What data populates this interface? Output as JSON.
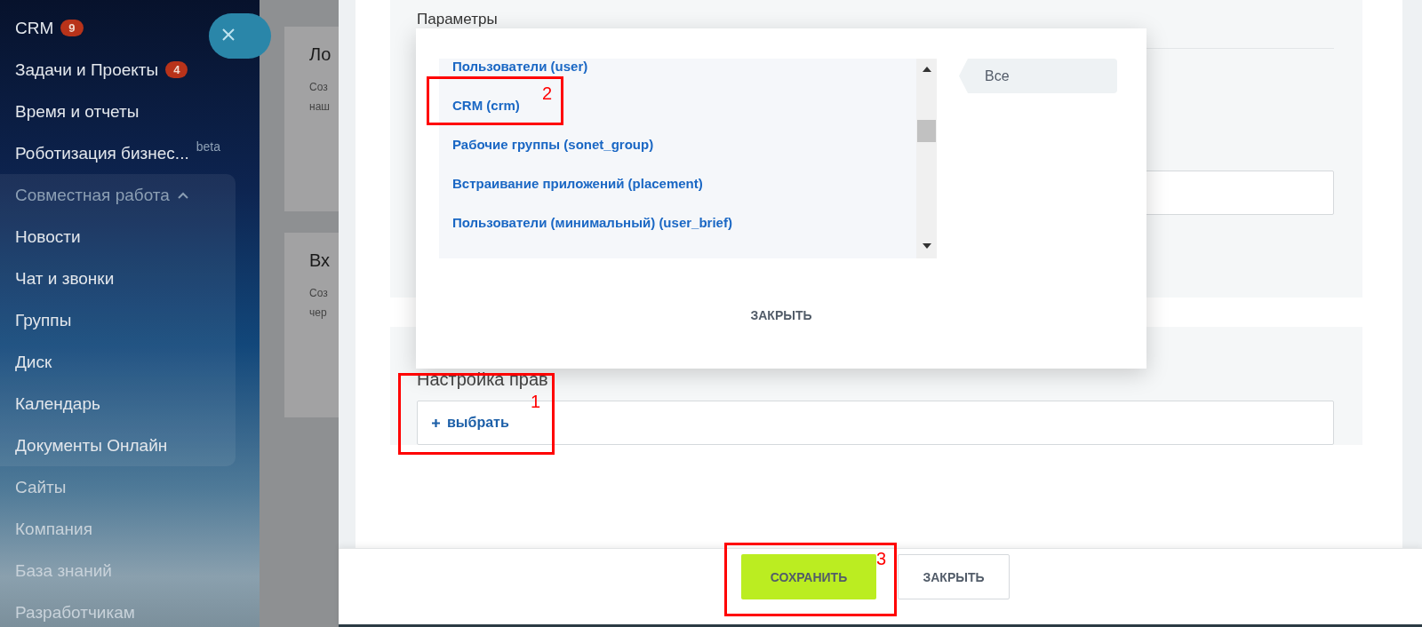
{
  "sidebar": {
    "items": [
      {
        "label": "CRM",
        "badge": "9"
      },
      {
        "label": "Задачи и Проекты",
        "badge": "4"
      },
      {
        "label": "Время и отчеты"
      },
      {
        "label": "Роботизация бизнес...",
        "superscript": "beta"
      },
      {
        "label": "Совместная работа",
        "expanded": true,
        "children": [
          {
            "label": "Новости"
          },
          {
            "label": "Чат и звонки"
          },
          {
            "label": "Группы"
          },
          {
            "label": "Диск"
          },
          {
            "label": "Календарь"
          },
          {
            "label": "Документы Онлайн"
          }
        ]
      },
      {
        "label": "Сайты"
      },
      {
        "label": "Компания"
      },
      {
        "label": "База знаний"
      },
      {
        "label": "Разработчикам"
      }
    ]
  },
  "background_cards": [
    {
      "title": "Ло",
      "lines": [
        "Соз",
        "наш"
      ]
    },
    {
      "title": "Вх",
      "lines": [
        "Соз",
        "чер"
      ]
    }
  ],
  "form": {
    "sections": [
      {
        "title": "Параметры"
      },
      {
        "title": "Настройка прав",
        "picker": "выбрать"
      }
    ]
  },
  "scope_popup": {
    "items": [
      "Пользователи (user)",
      "CRM (crm)",
      "Рабочие группы (sonet_group)",
      "Встраивание приложений (placement)",
      "Пользователи (минимальный) (user_brief)"
    ],
    "tag": "Все",
    "close": "ЗАКРЫТЬ"
  },
  "footer": {
    "buttons": [
      {
        "label": "СОХРАНИТЬ",
        "kind": "primary"
      },
      {
        "label": "ЗАКРЫТЬ",
        "kind": "secondary"
      }
    ]
  },
  "annotations": [
    {
      "number": "1"
    },
    {
      "number": "2"
    },
    {
      "number": "3"
    }
  ]
}
